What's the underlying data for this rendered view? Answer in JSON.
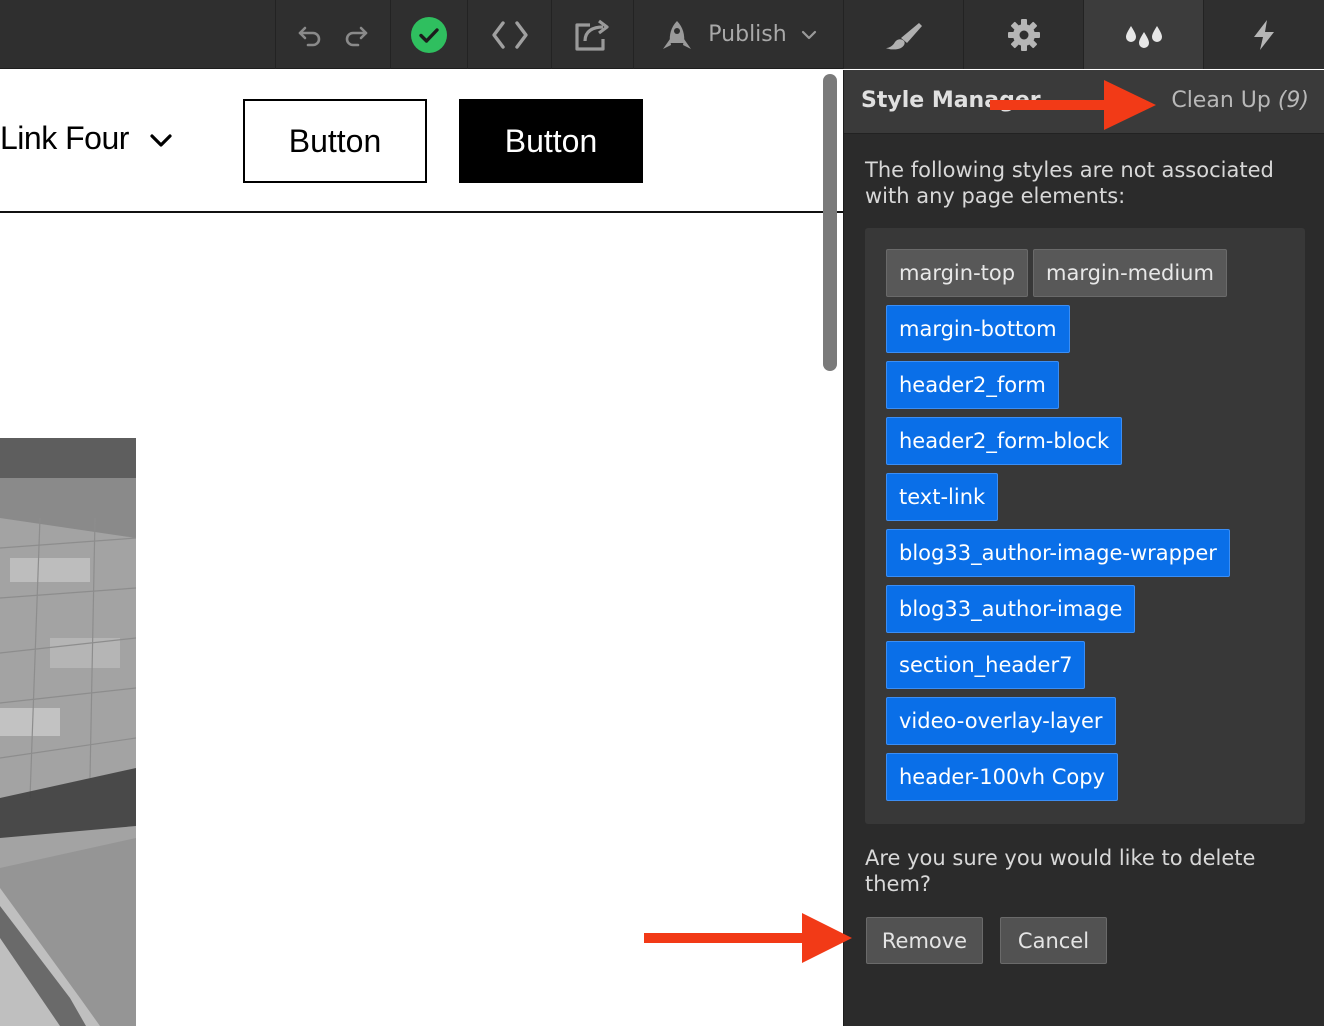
{
  "toolbar": {
    "publish_label": "Publish",
    "icons": [
      "undo-icon",
      "redo-icon",
      "check-circle-icon",
      "code-icon",
      "export-icon",
      "rocket-icon",
      "chevron-down-icon"
    ]
  },
  "panel_tabs": [
    "paintbrush-icon",
    "gear-icon",
    "drops-icon",
    "lightning-icon"
  ],
  "canvas": {
    "nav_link": "Link Four",
    "button_outline": "Button",
    "button_solid": "Button"
  },
  "style_manager": {
    "title": "Style Manager",
    "cleanup_label": "Clean Up",
    "cleanup_count": "(9)",
    "description": "The following styles are not associated with any page elements:",
    "tags": [
      {
        "label": "margin-top",
        "state": "unselected"
      },
      {
        "label": "margin-medium",
        "state": "unselected"
      },
      {
        "label": "margin-bottom",
        "state": "selected"
      },
      {
        "label": "header2_form",
        "state": "selected"
      },
      {
        "label": "header2_form-block",
        "state": "selected"
      },
      {
        "label": "text-link",
        "state": "selected"
      },
      {
        "label": "blog33_author-image-wrapper",
        "state": "selected"
      },
      {
        "label": "blog33_author-image",
        "state": "selected"
      },
      {
        "label": "section_header7",
        "state": "selected"
      },
      {
        "label": "video-overlay-layer",
        "state": "selected"
      },
      {
        "label": "header-100vh Copy",
        "state": "selected"
      }
    ],
    "confirm_text": "Are you sure you would like to delete them?",
    "remove_label": "Remove",
    "cancel_label": "Cancel"
  },
  "colors": {
    "accent_blue": "#0a6fe8",
    "annotation_arrow": "#f23a17",
    "success_green": "#2fbf5f",
    "panel_bg": "#2b2b2b"
  }
}
